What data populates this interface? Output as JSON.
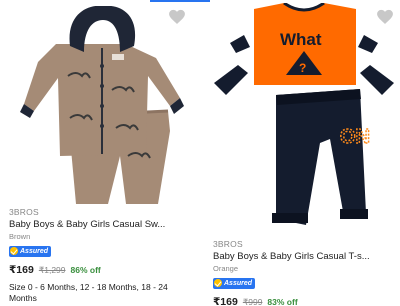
{
  "products": [
    {
      "brand": "3BROS",
      "title": "Baby Boys & Baby Girls Casual Sw...",
      "color": "Brown",
      "assured_label": "Assured",
      "price": "₹169",
      "mrp": "₹1,299",
      "discount": "86% off",
      "sizes": "Size 0 - 6 Months, 12 - 18 Months, 18 - 24 Months"
    },
    {
      "brand": "3BROS",
      "title": "Baby Boys & Baby Girls Casual T-s...",
      "color": "Orange",
      "assured_label": "Assured",
      "price": "₹169",
      "mrp": "₹999",
      "discount": "83% off",
      "print_text": "What",
      "pants_text": "ON"
    }
  ],
  "icons": {
    "wishlist": "heart-icon",
    "assured": "checkmark-badge-icon"
  },
  "colors": {
    "accent": "#2874f0",
    "discount": "#388e3c",
    "shirt_orange": "#ff6a00",
    "navy": "#141c2e",
    "brown_fabric": "#a58b76"
  }
}
